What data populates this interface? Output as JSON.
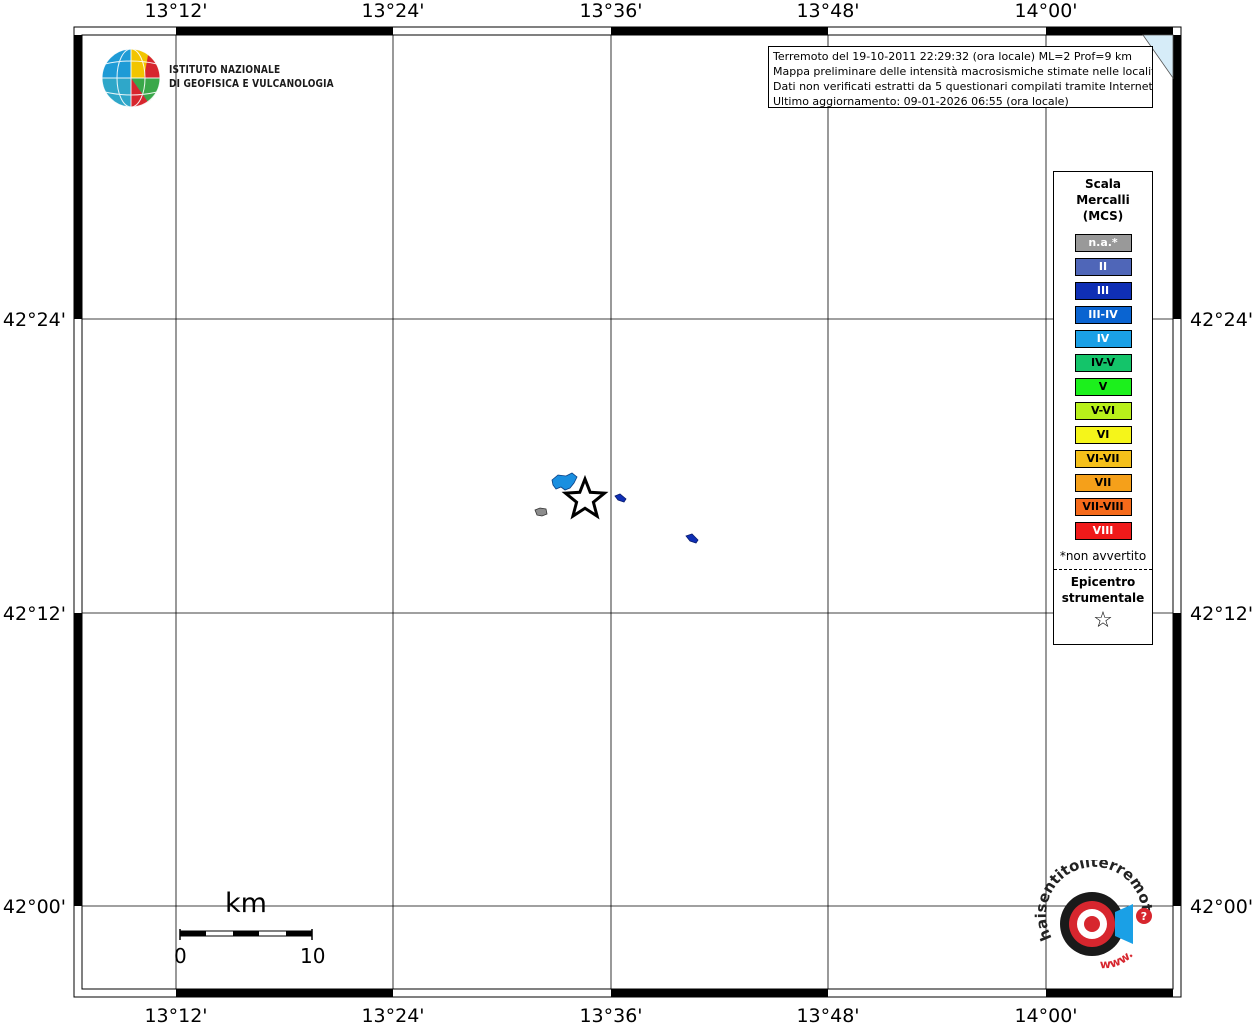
{
  "map": {
    "top_lon_labels": [
      "13°12'",
      "13°24'",
      "13°36'",
      "13°48'",
      "14°00'"
    ],
    "bottom_lon_labels": [
      "13°12'",
      "13°24'",
      "13°36'",
      "13°48'",
      "14°00'"
    ],
    "left_lat_labels": [
      "42°24'",
      "42°12'",
      "42°00'"
    ],
    "right_lat_labels": [
      "42°24'",
      "42°12'",
      "42°00'"
    ],
    "epicenter_icon": "star-outline",
    "intensity_points": [
      {
        "class": "IV",
        "color": "#1a8fe0"
      },
      {
        "class": "n.a.*",
        "color": "#8c8c8c"
      },
      {
        "class": "III",
        "color": "#0f2fb5"
      },
      {
        "class": "III",
        "color": "#0f2fb5"
      }
    ]
  },
  "institute": {
    "line1": "ISTITUTO NAZIONALE",
    "line2": "DI GEOFISICA E VULCANOLOGIA"
  },
  "info": {
    "line1": "Terremoto del 19-10-2011 22:29:32 (ora locale) ML=2 Prof=9 km",
    "line2": "Mappa preliminare delle intensità macrosismiche stimate nelle località",
    "line3": "Dati non verificati estratti da 5 questionari compilati tramite Internet.",
    "line4": "Ultimo aggiornamento: 09-01-2026 06:55 (ora locale)"
  },
  "legend": {
    "title_line1": "Scala",
    "title_line2": "Mercalli",
    "title_line3": "(MCS)",
    "items": [
      {
        "label": "n.a.*",
        "bg": "#999999",
        "fg": "#ffffff"
      },
      {
        "label": "II",
        "bg": "#4f66b8",
        "fg": "#ffffff"
      },
      {
        "label": "III",
        "bg": "#0f2fb5",
        "fg": "#ffffff"
      },
      {
        "label": "III-IV",
        "bg": "#0a64d1",
        "fg": "#ffffff"
      },
      {
        "label": "IV",
        "bg": "#1aa0e6",
        "fg": "#ffffff"
      },
      {
        "label": "IV-V",
        "bg": "#14c46a",
        "fg": "#000000"
      },
      {
        "label": "V",
        "bg": "#1cf01c",
        "fg": "#000000"
      },
      {
        "label": "V-VI",
        "bg": "#b8f01a",
        "fg": "#000000"
      },
      {
        "label": "VI",
        "bg": "#f5f51a",
        "fg": "#000000"
      },
      {
        "label": "VI-VII",
        "bg": "#f5c01a",
        "fg": "#000000"
      },
      {
        "label": "VII",
        "bg": "#f5a01a",
        "fg": "#000000"
      },
      {
        "label": "VII-VIII",
        "bg": "#f56a1a",
        "fg": "#000000"
      },
      {
        "label": "VIII",
        "bg": "#f01a1a",
        "fg": "#ffffff"
      }
    ],
    "note": "*non avvertito",
    "epi_line1": "Epicentro",
    "epi_line2": "strumentale",
    "epi_symbol": "☆"
  },
  "scalebar": {
    "unit": "km",
    "min_label": "0",
    "max_label": "10"
  },
  "hst_logo": {
    "text": "haisentitoilterremoto.it",
    "url_text": "www."
  }
}
